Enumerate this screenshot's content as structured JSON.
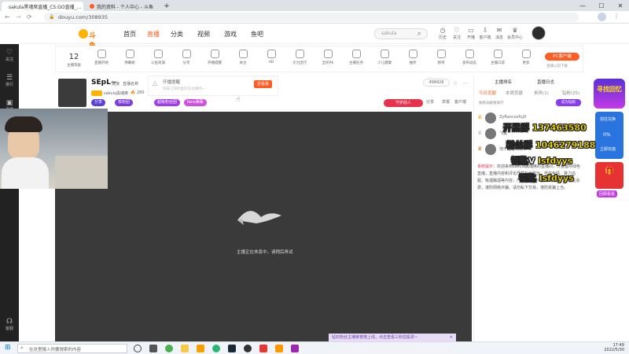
{
  "browser": {
    "tabs": [
      {
        "label": "sakula黑魂席直播_CS:GO直播_...",
        "active": true
      },
      {
        "label": "我的资料 - 个人中心 - 斗鱼",
        "active": false
      }
    ],
    "new_tab": "+",
    "url": "douyu.com/308935",
    "win_min": "—",
    "win_max": "☐",
    "win_close": "✕"
  },
  "site": {
    "logo": "斗鱼",
    "nav": [
      "首页",
      "直播",
      "分类",
      "视频",
      "游戏",
      "鱼吧"
    ],
    "nav_active": 1,
    "search_placeholder": "sakula",
    "header_icons": [
      "历史",
      "关注",
      "开播",
      "客户端",
      "消息",
      "会员中心"
    ],
    "accent": "#ff5d23"
  },
  "leftbar": {
    "items": [
      "关注",
      "排行",
      "录屏"
    ],
    "bottom": "客服"
  },
  "toolrow": {
    "level": "12",
    "level_label": "主播等级",
    "tools": [
      "直播开始",
      "弹幕姬",
      "斗鱼商城",
      "分享",
      "开播提醒",
      "关注",
      "AD",
      "大力出行",
      "全民PK",
      "主播任务",
      "少儿健康",
      "抽奖",
      "榜单",
      "发布动态",
      "主播口袋",
      "更多"
    ],
    "pc_client": "PC客户端",
    "pc_sub": "直播以前下载"
  },
  "stream": {
    "name": "SEpL~",
    "tags": [
      "链接",
      "直播名称"
    ],
    "host": "sakula黑魂席",
    "heat": "280",
    "remind_title": "开播提醒",
    "remind_desc": "快来订阅你喜欢的主播吧~",
    "follow_btn": "去看看",
    "badges": [
      "分享",
      "铁粉团",
      "超级粉丝团",
      "fans弹幕"
    ],
    "room_id": "498426",
    "action_share": "分享",
    "action_report": "举报",
    "action_client": "客户端",
    "hot_btn": "守护前人",
    "offline_text": "主播正在休息中，请稍后再试"
  },
  "rightpanel": {
    "title": "主播排名",
    "btn": "直播日志",
    "tabs": [
      "今日贡献",
      "本周贡献",
      "贵宾(1)",
      "钻粉(25)"
    ],
    "rank_title": "按照贡献值排行",
    "rank_btn": "成为钻粉",
    "rankers": [
      "ZyRancxxfuJX",
      "飞翼",
      "地不雅老司机"
    ],
    "system_label": "系统提示：",
    "system_text": "欢迎来到sakula黑魂席的直播间，斗鱼倡导绿色直播，直播内容和评论严禁包含政治、低俗色情、暴力血腥、吸烟酗酒等内容，严禁未成年人直播或打赏，请理性消费，谨防网络诈骗。请勿私下交易，谨防受骗上当。"
  },
  "overlay": {
    "line1": "开黑群",
    "line1_num": "137463580",
    "line2": "粉丝群",
    "line2_num": "1046279188",
    "line3": "钥匙V",
    "line3_num": "lsfdyys",
    "line4": "钥匙",
    "line4_num": "lsfdyys"
  },
  "promo": {
    "text": "寻找回忆",
    "stats": [
      "前往兑换",
      "0%",
      "立即充值"
    ],
    "footer": "回顾看看"
  },
  "notice": {
    "text": "钻石粉丝主播荣誉榜上线，点击查看三秒前投票~"
  },
  "taskbar": {
    "search_placeholder": "在这里输入你要搜索的内容",
    "time": "17:49",
    "date": "2022/5/30"
  }
}
